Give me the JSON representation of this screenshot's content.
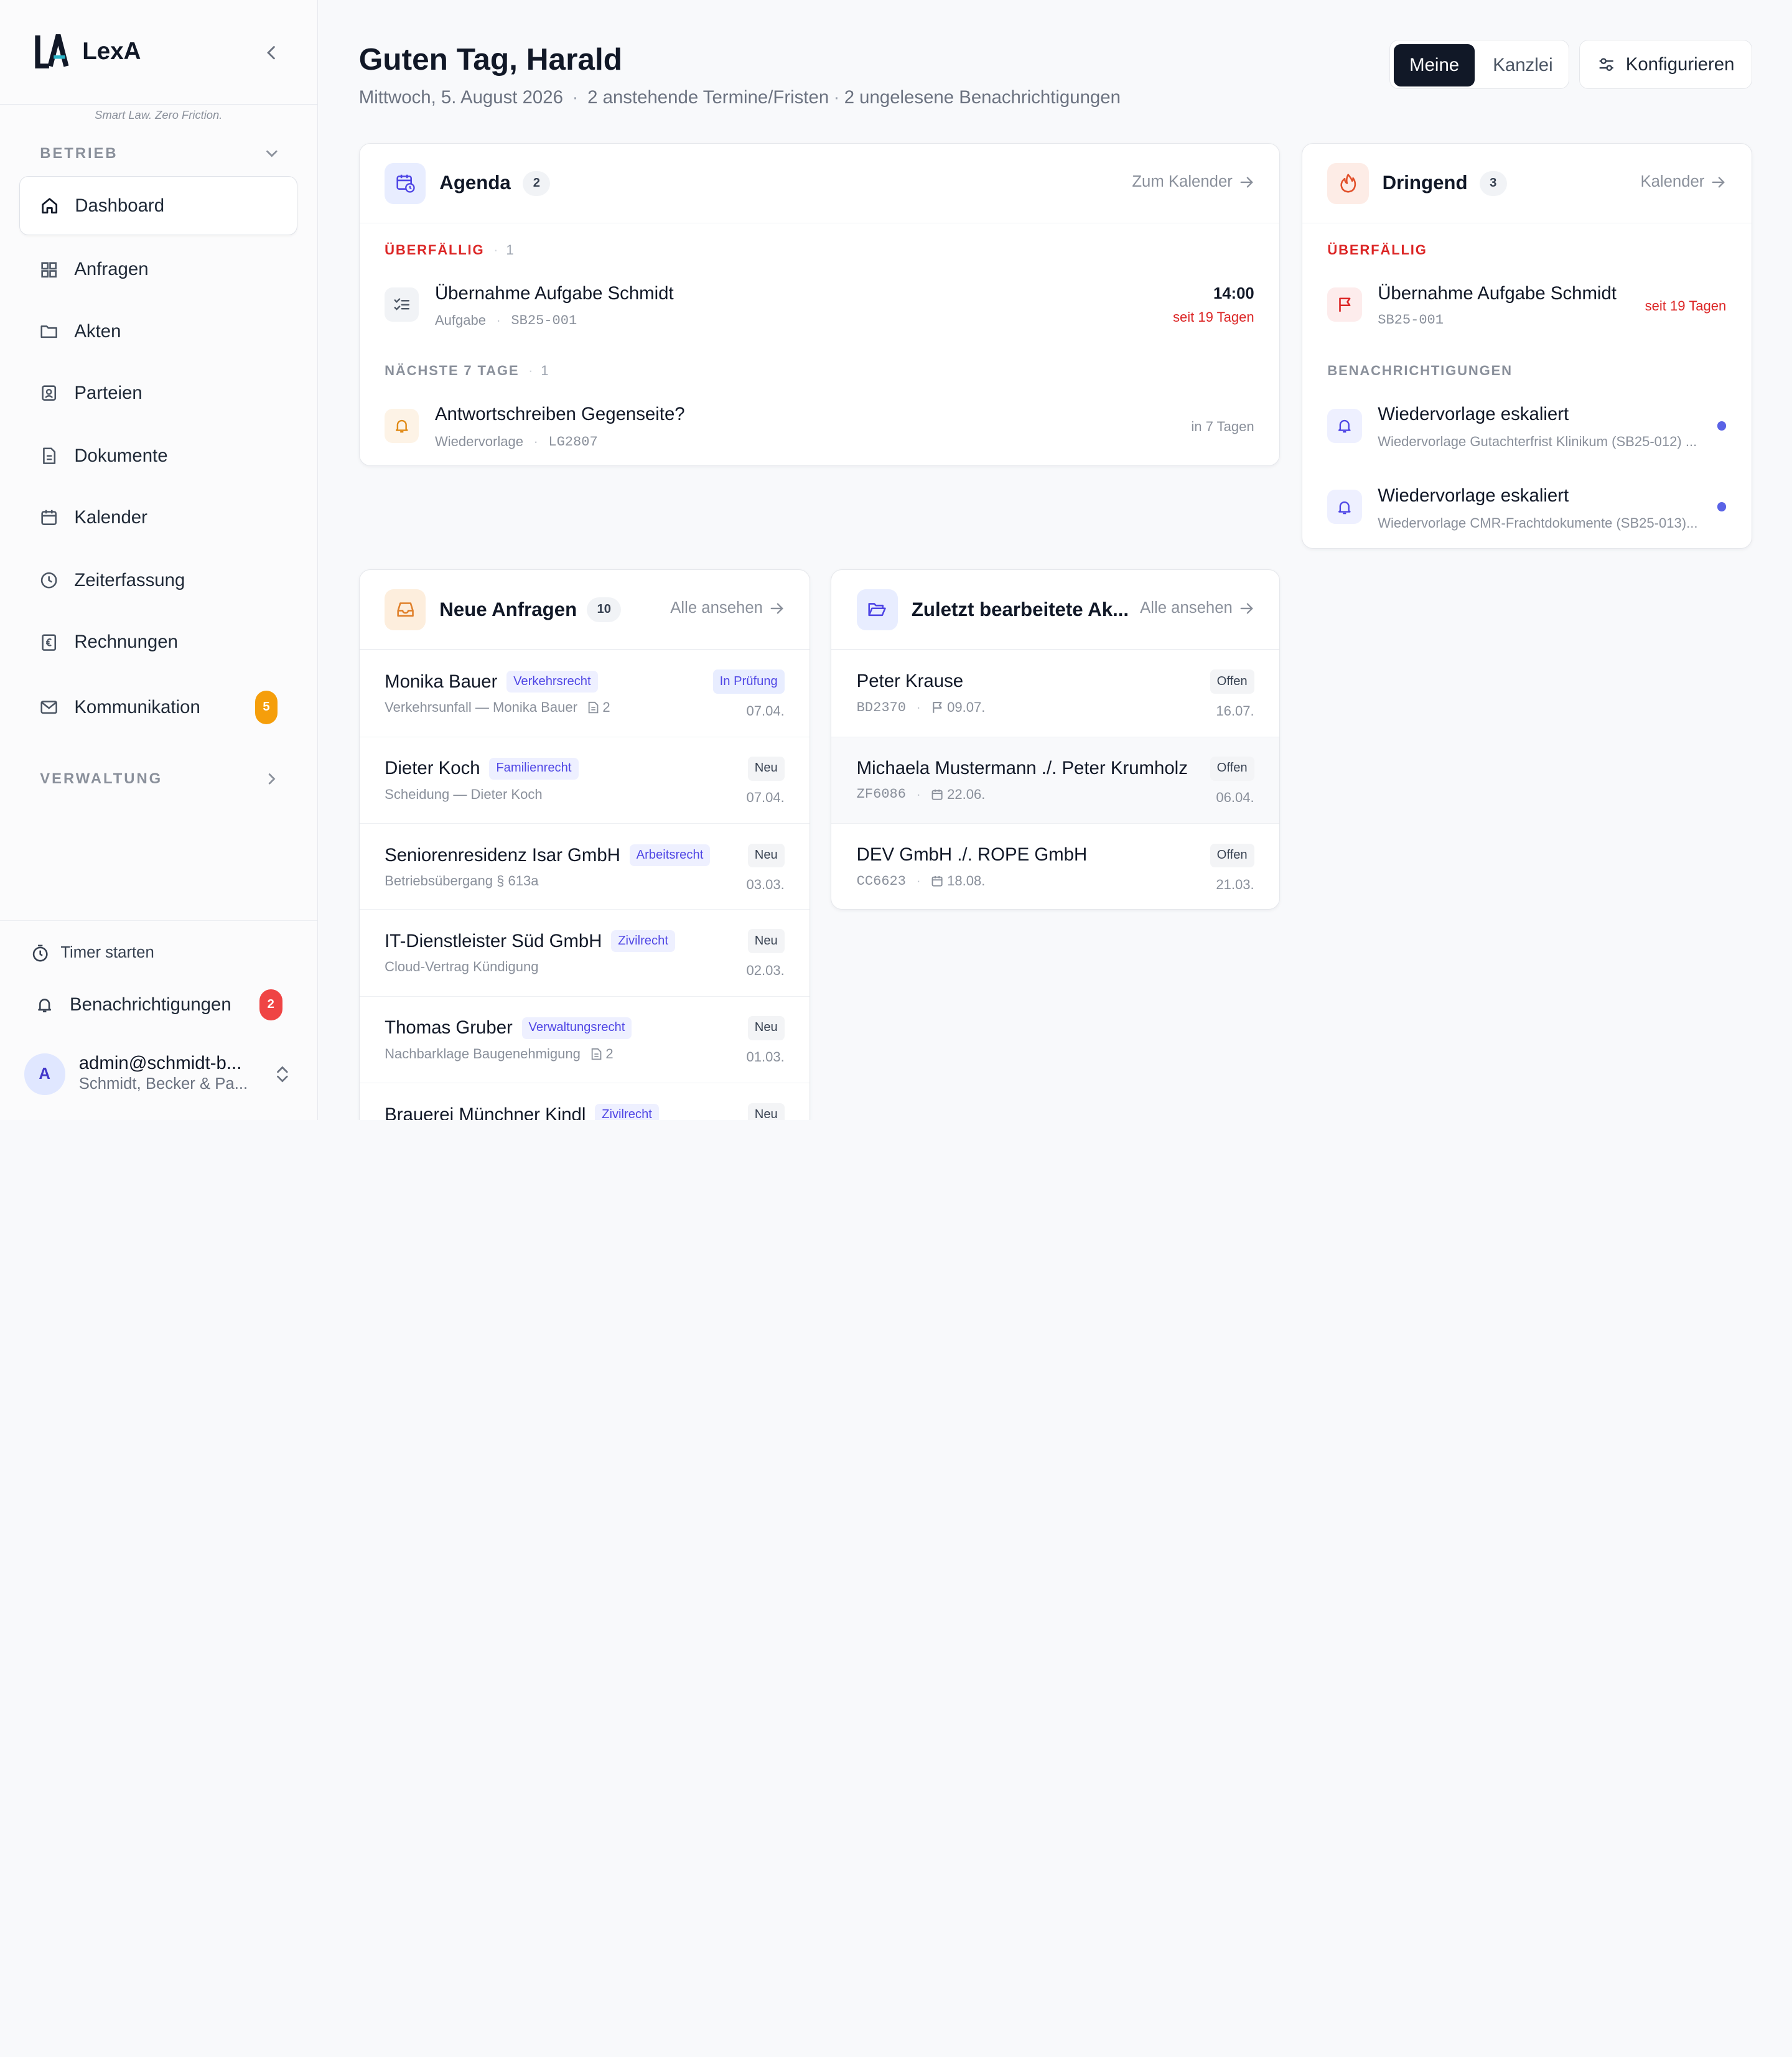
{
  "brand": {
    "name": "LexA",
    "tagline": "Smart Law. Zero Friction."
  },
  "sidebar": {
    "section_betrieb": "BETRIEB",
    "section_verwaltung": "VERWALTUNG",
    "items": [
      {
        "label": "Dashboard",
        "icon": "home-icon"
      },
      {
        "label": "Anfragen",
        "icon": "grid-icon"
      },
      {
        "label": "Akten",
        "icon": "folder-icon"
      },
      {
        "label": "Parteien",
        "icon": "contact-icon"
      },
      {
        "label": "Dokumente",
        "icon": "document-icon"
      },
      {
        "label": "Kalender",
        "icon": "calendar-icon"
      },
      {
        "label": "Zeiterfassung",
        "icon": "clock-icon"
      },
      {
        "label": "Rechnungen",
        "icon": "euro-receipt-icon"
      },
      {
        "label": "Kommunikation",
        "icon": "mail-icon",
        "badge": "5"
      }
    ],
    "timer": "Timer starten",
    "notifications": {
      "label": "Benachrichtigungen",
      "badge": "2"
    },
    "user": {
      "initial": "A",
      "email": "admin@schmidt-b...",
      "org": "Schmidt, Becker & Pa..."
    }
  },
  "header": {
    "greeting": "Guten Tag, Harald",
    "date": "Mittwoch, 5. August 2026",
    "pending": "2 anstehende Termine/Fristen",
    "unread": "2 ungelesene Benachrichtigungen",
    "toggle": {
      "mine": "Meine",
      "firm": "Kanzlei"
    },
    "configure": "Konfigurieren"
  },
  "agenda": {
    "title": "Agenda",
    "count": "2",
    "link": "Zum Kalender",
    "overdue_label": "ÜBERFÄLLIG",
    "overdue_count": "1",
    "overdue_item": {
      "title": "Übernahme Aufgabe Schmidt",
      "type": "Aufgabe",
      "ref": "SB25-001",
      "time": "14:00",
      "since": "seit 19 Tagen"
    },
    "next_label": "NÄCHSTE 7 TAGE",
    "next_count": "1",
    "next_item": {
      "title": "Antwortschreiben Gegenseite?",
      "type": "Wiedervorlage",
      "ref": "LG2807",
      "when": "in 7 Tagen"
    }
  },
  "urgent": {
    "title": "Dringend",
    "count": "3",
    "link": "Kalender",
    "overdue_label": "ÜBERFÄLLIG",
    "overdue_item": {
      "title": "Übernahme Aufgabe Schmidt",
      "ref": "SB25-001",
      "since": "seit 19 Tagen"
    },
    "notif_label": "BENACHRICHTIGUNGEN",
    "notifs": [
      {
        "title": "Wiedervorlage eskaliert",
        "text": "Wiedervorlage Gutachterfrist Klinikum (SB25-012) ..."
      },
      {
        "title": "Wiedervorlage eskaliert",
        "text": "Wiedervorlage CMR-Frachtdokumente (SB25-013)..."
      }
    ]
  },
  "requests": {
    "title": "Neue Anfragen",
    "count": "10",
    "link": "Alle ansehen",
    "rows": [
      {
        "name": "Monika Bauer",
        "tag": "Verkehrsrecht",
        "sub": "Verkehrsunfall — Monika Bauer",
        "docs": "2",
        "status": "In Prüfung",
        "date": "07.04."
      },
      {
        "name": "Dieter Koch",
        "tag": "Familienrecht",
        "sub": "Scheidung — Dieter Koch",
        "status": "Neu",
        "date": "07.04."
      },
      {
        "name": "Seniorenresidenz Isar GmbH",
        "tag": "Arbeitsrecht",
        "sub": "Betriebsübergang § 613a",
        "status": "Neu",
        "date": "03.03."
      },
      {
        "name": "IT-Dienstleister Süd GmbH",
        "tag": "Zivilrecht",
        "sub": "Cloud-Vertrag Kündigung",
        "status": "Neu",
        "date": "02.03."
      },
      {
        "name": "Thomas Gruber",
        "tag": "Verwaltungsrecht",
        "sub": "Nachbarklage Baugenehmigung",
        "docs": "2",
        "status": "Neu",
        "date": "01.03."
      },
      {
        "name": "Brauerei Münchner Kindl",
        "tag": "Zivilrecht",
        "status": "Neu"
      }
    ]
  },
  "files": {
    "title": "Zuletzt bearbeitete Ak...",
    "link": "Alle ansehen",
    "rows": [
      {
        "name": "Peter Krause",
        "ref": "BD2370",
        "date2": "09.07.",
        "status": "Offen",
        "date": "16.07."
      },
      {
        "name": "Michaela Mustermann ./. Peter Krumholz",
        "ref": "ZF6086",
        "date2": "22.06.",
        "status": "Offen",
        "date": "06.04."
      },
      {
        "name": "DEV GmbH ./. ROPE GmbH",
        "ref": "CC6623",
        "date2": "18.08.",
        "status": "Offen",
        "date": "21.03."
      }
    ]
  }
}
